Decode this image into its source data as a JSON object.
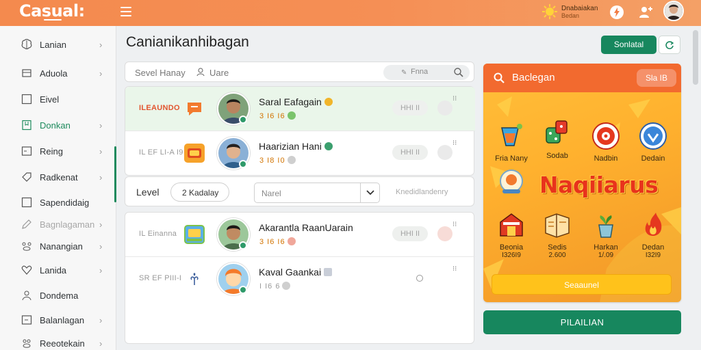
{
  "topbar": {
    "logo": "Casual:",
    "brand_line1": "Dnabaiakan",
    "brand_line2": "Bedan"
  },
  "sidebar": {
    "items": [
      {
        "label": "Lanian",
        "icon": "brain-icon"
      },
      {
        "label": "Aduola",
        "icon": "ticket-icon"
      },
      {
        "label": "Eivel",
        "icon": "square-icon"
      },
      {
        "label": "Donkan",
        "icon": "bookmark-icon"
      },
      {
        "label": "Reing",
        "icon": "tablet-icon"
      },
      {
        "label": "Radkenat",
        "icon": "tag-icon"
      },
      {
        "label": "Sapendidaig",
        "icon": "square-icon"
      },
      {
        "label": "Bagnlagaman",
        "icon": "pen-icon"
      },
      {
        "label": "Nanangian",
        "icon": "paw-icon"
      },
      {
        "label": "Lanida",
        "icon": "heart-icon"
      },
      {
        "label": "Dondema",
        "icon": "person-icon"
      },
      {
        "label": "Balanlagan",
        "icon": "tablet-icon"
      },
      {
        "label": "Reeotekain",
        "icon": "paw-icon"
      }
    ]
  },
  "main": {
    "title": "Canianikanhibagan",
    "search_text": "Sevel Hanay",
    "search_user": "Uare",
    "search_pill": "Fnna",
    "rows": [
      {
        "rank": "ILEAUNDO",
        "name": "Saral Eafagain",
        "stats": "3 I6 I6",
        "action": "HHI II",
        "hot": true
      },
      {
        "rank": "IL EF LI-A I9",
        "name": "Haarizian Hani",
        "stats": "3 I8 I0",
        "action": "HHI II",
        "hot": false
      },
      {
        "rank": "IL Einanna",
        "name": "Akarantla RaanUarain",
        "stats": "3 I6 I6",
        "action": "HHI II",
        "hot": false
      },
      {
        "rank": "SR EF PIII-I",
        "name": "Kaval Gaankai",
        "stats": "I I6 6",
        "action": "",
        "hot": false
      }
    ],
    "level": {
      "label": "Level",
      "select1": "2 Kadalay",
      "select2": "Narel",
      "placeholder": "Knedidlandenry"
    }
  },
  "right": {
    "primary_button": "Sonlatal",
    "promo_title": "Baclegan",
    "promo_pill": "Sla IB",
    "games_top": [
      {
        "label": "Fria Nany",
        "icon": "cocktail-icon"
      },
      {
        "label": "Sodab",
        "icon": "dice-icon"
      },
      {
        "label": "Nadbin",
        "icon": "target-icon"
      },
      {
        "label": "Dedain",
        "icon": "shield-icon"
      }
    ],
    "big_word": "Naqiiarus",
    "games_bottom": [
      {
        "label": "Beonia",
        "sub": "I326I9",
        "icon": "barn-icon"
      },
      {
        "label": "Sedis",
        "sub": "2.600",
        "icon": "book-icon"
      },
      {
        "label": "Harkan",
        "sub": "1/.09",
        "icon": "plant-icon"
      },
      {
        "label": "Dedan",
        "sub": "I32I9",
        "icon": "fire-icon"
      }
    ],
    "promo_cta": "Seaaunel",
    "big_button": "PILAILIAN"
  },
  "colors": {
    "topbar": "#f48a4e",
    "accent_green": "#17875e",
    "promo_header": "#f26a2f",
    "promo_bg": "#ffb12e"
  }
}
